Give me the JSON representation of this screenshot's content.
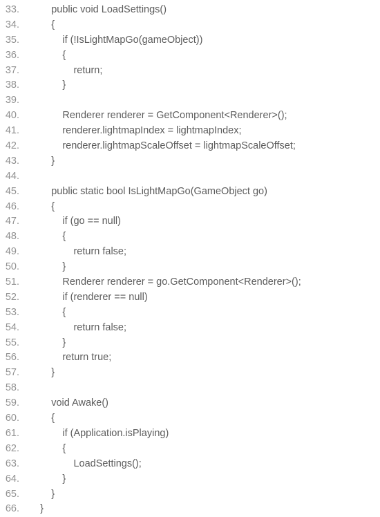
{
  "lines": [
    {
      "n": "33.",
      "indent": 2,
      "text": "public void LoadSettings()"
    },
    {
      "n": "34.",
      "indent": 2,
      "text": "{"
    },
    {
      "n": "35.",
      "indent": 3,
      "text": "if (!IsLightMapGo(gameObject))"
    },
    {
      "n": "36.",
      "indent": 3,
      "text": "{"
    },
    {
      "n": "37.",
      "indent": 4,
      "text": "return;"
    },
    {
      "n": "38.",
      "indent": 3,
      "text": "}"
    },
    {
      "n": "39.",
      "indent": 0,
      "text": ""
    },
    {
      "n": "40.",
      "indent": 3,
      "text": "Renderer renderer = GetComponent<Renderer>();"
    },
    {
      "n": "41.",
      "indent": 3,
      "text": "renderer.lightmapIndex = lightmapIndex;"
    },
    {
      "n": "42.",
      "indent": 3,
      "text": "renderer.lightmapScaleOffset = lightmapScaleOffset;"
    },
    {
      "n": "43.",
      "indent": 2,
      "text": "}"
    },
    {
      "n": "44.",
      "indent": 0,
      "text": ""
    },
    {
      "n": "45.",
      "indent": 2,
      "text": "public static bool IsLightMapGo(GameObject go)"
    },
    {
      "n": "46.",
      "indent": 2,
      "text": "{"
    },
    {
      "n": "47.",
      "indent": 3,
      "text": "if (go == null)"
    },
    {
      "n": "48.",
      "indent": 3,
      "text": "{"
    },
    {
      "n": "49.",
      "indent": 4,
      "text": "return false;"
    },
    {
      "n": "50.",
      "indent": 3,
      "text": "}"
    },
    {
      "n": "51.",
      "indent": 3,
      "text": "Renderer renderer = go.GetComponent<Renderer>();"
    },
    {
      "n": "52.",
      "indent": 3,
      "text": "if (renderer == null)"
    },
    {
      "n": "53.",
      "indent": 3,
      "text": "{"
    },
    {
      "n": "54.",
      "indent": 4,
      "text": "return false;"
    },
    {
      "n": "55.",
      "indent": 3,
      "text": "}"
    },
    {
      "n": "56.",
      "indent": 3,
      "text": "return true;"
    },
    {
      "n": "57.",
      "indent": 2,
      "text": "}"
    },
    {
      "n": "58.",
      "indent": 0,
      "text": ""
    },
    {
      "n": "59.",
      "indent": 2,
      "text": "void Awake()"
    },
    {
      "n": "60.",
      "indent": 2,
      "text": "{"
    },
    {
      "n": "61.",
      "indent": 3,
      "text": "if (Application.isPlaying)"
    },
    {
      "n": "62.",
      "indent": 3,
      "text": "{"
    },
    {
      "n": "63.",
      "indent": 4,
      "text": "LoadSettings();"
    },
    {
      "n": "64.",
      "indent": 3,
      "text": "}"
    },
    {
      "n": "65.",
      "indent": 2,
      "text": "}"
    },
    {
      "n": "66.",
      "indent": 1,
      "text": "}"
    }
  ],
  "indent_unit": "    "
}
